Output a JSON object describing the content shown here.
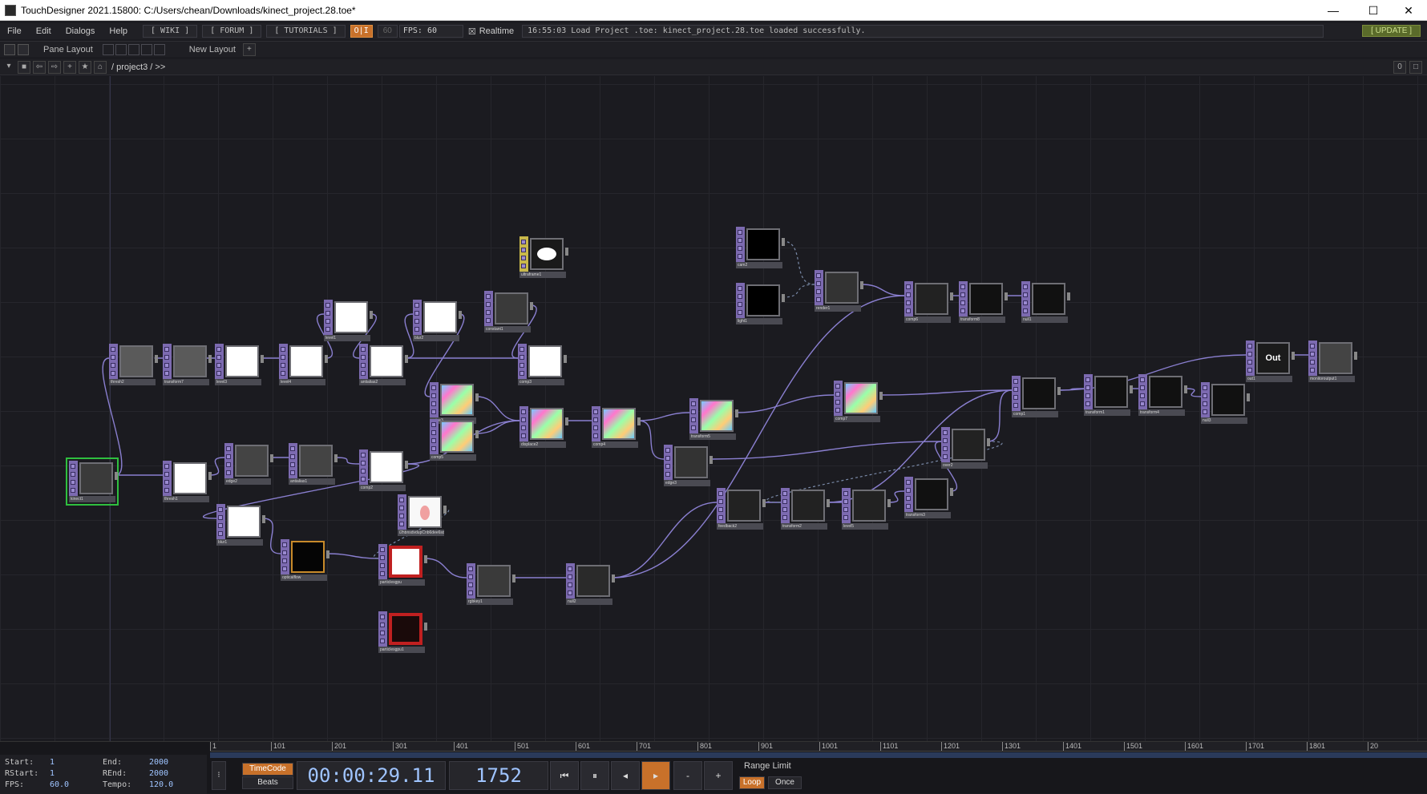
{
  "window": {
    "title": "TouchDesigner 2021.15800: C:/Users/chean/Downloads/kinect_project.28.toe*",
    "minimize": "—",
    "maximize": "☐",
    "close": "✕"
  },
  "menubar": {
    "items": [
      "File",
      "Edit",
      "Dialogs",
      "Help"
    ],
    "wiki": "[ WIKI ]",
    "forum": "[ FORUM ]",
    "tutorials": "[ TUTORIALS ]",
    "oi": "O|I",
    "fps_cap": "60",
    "fps": "FPS:  60",
    "realtime": "Realtime",
    "realtime_check": "☒",
    "status": "16:55:03 Load Project .toe: kinect_project.28.toe loaded successfully.",
    "update": "[ UPDATE ]"
  },
  "panebar": {
    "pane_layout": "Pane Layout",
    "new_layout": "New Layout",
    "add": "+"
  },
  "pathbar": {
    "path": "/ project3 / >>",
    "counter": "0"
  },
  "nodes": [
    {
      "id": "kinect1",
      "label": "kinect1"
    },
    {
      "id": "thresh2",
      "label": "thresh2"
    },
    {
      "id": "transform7",
      "label": "transform7"
    },
    {
      "id": "level3",
      "label": "level3"
    },
    {
      "id": "level4",
      "label": "level4"
    },
    {
      "id": "level1",
      "label": "level1"
    },
    {
      "id": "blur2",
      "label": "blur2"
    },
    {
      "id": "constant1",
      "label": "constant1"
    },
    {
      "id": "antialias2",
      "label": "antialias2"
    },
    {
      "id": "comp3",
      "label": "comp3"
    },
    {
      "id": "ultraframe1",
      "label": "ultraframe1"
    },
    {
      "id": "noise3",
      "label": "noise3"
    },
    {
      "id": "comp5",
      "label": "comp5"
    },
    {
      "id": "displace2",
      "label": "displace2"
    },
    {
      "id": "comp4",
      "label": "comp4"
    },
    {
      "id": "transform5",
      "label": "transform5"
    },
    {
      "id": "thresh1",
      "label": "thresh1"
    },
    {
      "id": "edge2",
      "label": "edge2"
    },
    {
      "id": "antialias1",
      "label": "antialias1"
    },
    {
      "id": "comp2",
      "label": "comp2"
    },
    {
      "id": "blur1",
      "label": "blur1"
    },
    {
      "id": "opticalflow",
      "label": "opticalflow"
    },
    {
      "id": "iquad",
      "label": "i2hbnsdvdupCnb6dee6sdhpehttvb7b61nb0edf01c80860d0de6f0aeb0cbe6f5"
    },
    {
      "id": "particlesgpu",
      "label": "particlesgpu"
    },
    {
      "id": "rgbkey1",
      "label": "rgbkey1"
    },
    {
      "id": "null2",
      "label": "null2"
    },
    {
      "id": "particlesgpu1",
      "label": "particlesgpu1"
    },
    {
      "id": "cam2",
      "label": "cam2"
    },
    {
      "id": "light1",
      "label": "light1"
    },
    {
      "id": "render1",
      "label": "render1"
    },
    {
      "id": "comp6",
      "label": "comp6"
    },
    {
      "id": "transform8",
      "label": "transform8"
    },
    {
      "id": "null1",
      "label": "null1"
    },
    {
      "id": "comp7",
      "label": "comp7"
    },
    {
      "id": "edge3",
      "label": "edge3"
    },
    {
      "id": "feedback2",
      "label": "feedback2"
    },
    {
      "id": "transform2",
      "label": "transform2"
    },
    {
      "id": "level5",
      "label": "level5"
    },
    {
      "id": "transform3",
      "label": "transform3"
    },
    {
      "id": "over2",
      "label": "over2"
    },
    {
      "id": "comp1",
      "label": "comp1"
    },
    {
      "id": "transform1",
      "label": "transform1"
    },
    {
      "id": "transform4",
      "label": "transform4"
    },
    {
      "id": "null3",
      "label": "null3"
    },
    {
      "id": "out1",
      "label": "out1",
      "text": "Out"
    },
    {
      "id": "monitoroutput1",
      "label": "monitoroutput1"
    }
  ],
  "timeline": {
    "ruler": [
      "1",
      "101",
      "201",
      "301",
      "401",
      "501",
      "601",
      "701",
      "801",
      "901",
      "1001",
      "1101",
      "1201",
      "1301",
      "1401",
      "1501",
      "1601",
      "1701",
      "1801",
      "20"
    ],
    "start_label": "Start:",
    "start": "1",
    "rstart_label": "RStart:",
    "rstart": "1",
    "fps_label": "FPS:",
    "fps": "60.0",
    "end_label": "End:",
    "end": "2000",
    "rend_label": "REnd:",
    "rend": "2000",
    "tempo_label": "Tempo:",
    "tempo": "120.0",
    "timecode_btn": "TimeCode",
    "beats_btn": "Beats",
    "timecode": "00:00:29.11",
    "frame": "1752",
    "range_limit": "Range Limit",
    "loop": "Loop",
    "once": "Once",
    "colors": {
      "accent": "#c8712a",
      "timecode_text": "#9fc4ff"
    }
  }
}
